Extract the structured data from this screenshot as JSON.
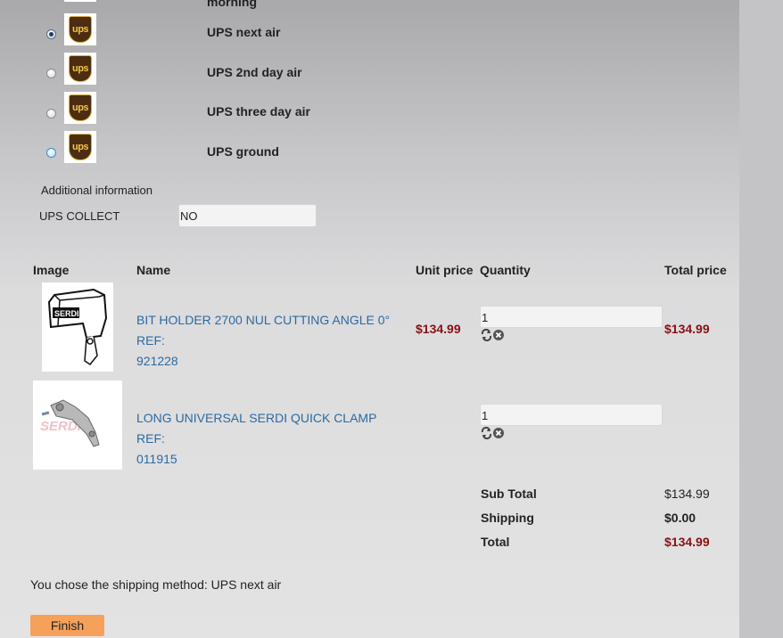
{
  "shipping": {
    "partial_top_label": "morning",
    "options": [
      {
        "label": "UPS next air",
        "selected": true
      },
      {
        "label": "UPS 2nd day air",
        "selected": false
      },
      {
        "label": "UPS three day air",
        "selected": false
      },
      {
        "label": "UPS ground",
        "selected": false
      }
    ],
    "logo_text": "ups"
  },
  "additional": {
    "heading": "Additional information",
    "ups_collect_label": "UPS COLLECT",
    "ups_collect_value": "NO"
  },
  "cart": {
    "headers": {
      "image": "Image",
      "name": "Name",
      "unit_price": "Unit price",
      "quantity": "Quantity",
      "total_price": "Total price"
    },
    "items": [
      {
        "name_line1": "BIT HOLDER 2700 NUL CUTTING ANGLE 0° REF:",
        "name_line2": "921228",
        "unit_price": "$134.99",
        "quantity": "1",
        "total_price": "$134.99",
        "image_text": "SERDI"
      },
      {
        "name_line1": "LONG UNIVERSAL SERDI QUICK CLAMP REF:",
        "name_line2": "011915",
        "unit_price": "",
        "quantity": "1",
        "total_price": "",
        "image_text": "SERDI"
      }
    ],
    "summary": {
      "subtotal_label": "Sub Total",
      "subtotal_value": "$134.99",
      "shipping_label": "Shipping",
      "shipping_value": "$0.00",
      "total_label": "Total",
      "total_value": "$134.99"
    }
  },
  "chosen_text": "You chose the shipping method: UPS next air",
  "finish_label": "Finish",
  "colors": {
    "link": "#2c6aa0",
    "price": "#8a0f14",
    "finish_button": "#f6a15a"
  }
}
